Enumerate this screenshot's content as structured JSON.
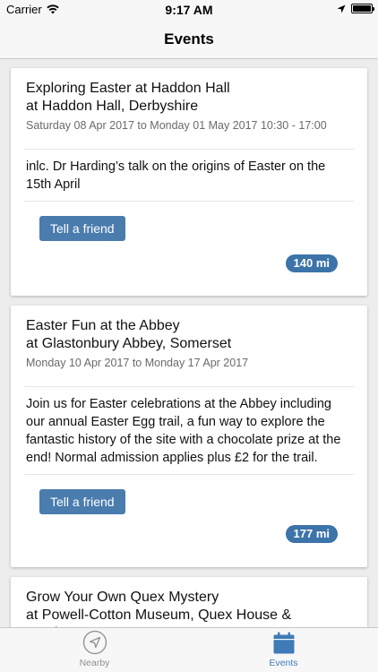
{
  "status_bar": {
    "carrier": "Carrier",
    "time": "9:17 AM"
  },
  "nav": {
    "title": "Events"
  },
  "events": [
    {
      "title_line1": "Exploring Easter at Haddon Hall",
      "title_line2": "at Haddon Hall, Derbyshire",
      "dates": "Saturday 08 Apr 2017 to Monday 01 May 2017 10:30 - 17:00",
      "description": "inlc. Dr Harding’s talk on the origins of Easter on the 15th April",
      "button_label": "Tell a friend",
      "distance": "140 mi"
    },
    {
      "title_line1": "Easter Fun at the Abbey",
      "title_line2": "at Glastonbury Abbey, Somerset",
      "dates": "Monday 10 Apr 2017 to Monday 17 Apr 2017",
      "description": "Join us for Easter celebrations at the Abbey including our annual Easter Egg trail, a fun way to explore the fantastic history of the site with a chocolate prize at the end! Normal admission applies plus £2 for the trail.",
      "button_label": "Tell a friend",
      "distance": "177 mi"
    },
    {
      "title_line1": "Grow Your Own Quex Mystery",
      "title_line2": "at Powell-Cotton Museum, Quex House & Gardens, Kent"
    }
  ],
  "tabs": [
    {
      "label": "Nearby",
      "icon": "location-arrow-icon"
    },
    {
      "label": "Events",
      "icon": "calendar-icon"
    }
  ],
  "colors": {
    "accent": "#3f7bb6",
    "button": "#4a7cae",
    "badge": "#3c73a8",
    "inactive_tab": "#8e8e93"
  }
}
